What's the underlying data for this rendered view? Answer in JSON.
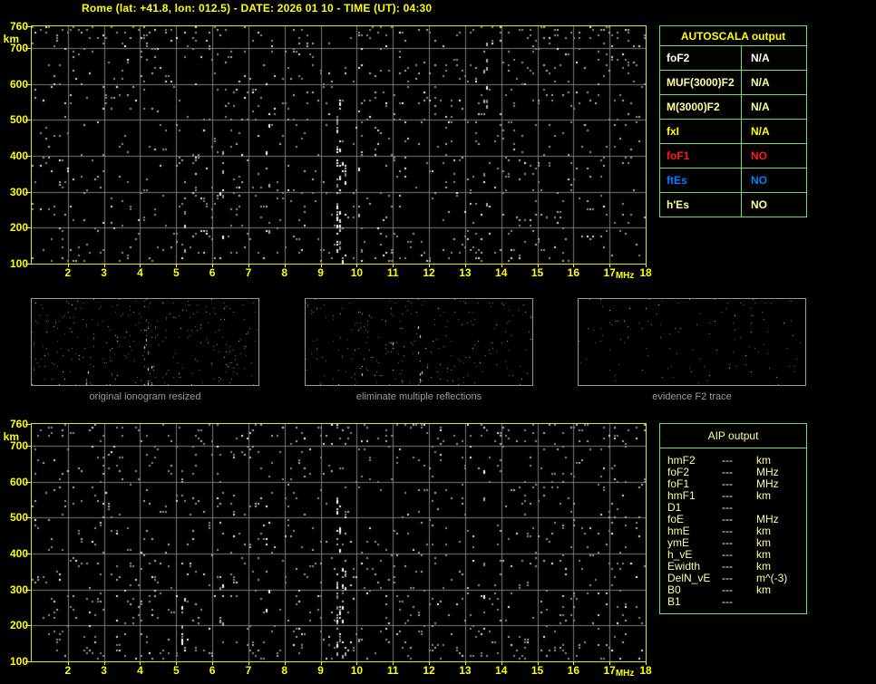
{
  "title": "Rome (lat: +41.8, lon: 012.5) - DATE: 2026 01 10 - TIME (UT): 04:30",
  "colors": {
    "accent_yellow": "#ffff00",
    "pale_yellow": "#ffff9b",
    "red": "#ff1a1a",
    "blue": "#0080ff",
    "white": "#ffffff",
    "table_border_green": "#6fde6f",
    "grid_gray": "#7b7b7b",
    "caption_gray": "#9b9b9b"
  },
  "ionogram": {
    "y_unit": "km",
    "x_unit": "MHz",
    "y_ticks": [
      "760",
      "700",
      "600",
      "500",
      "400",
      "300",
      "200",
      "100"
    ],
    "y_tick_values": [
      760,
      700,
      600,
      500,
      400,
      300,
      200,
      100
    ],
    "x_ticks": [
      "2",
      "3",
      "4",
      "5",
      "6",
      "7",
      "8",
      "9",
      "10",
      "11",
      "12",
      "13",
      "14",
      "15",
      "16",
      "17",
      "18"
    ],
    "x_tick_values": [
      2,
      3,
      4,
      5,
      6,
      7,
      8,
      9,
      10,
      11,
      12,
      13,
      14,
      15,
      16,
      17,
      18
    ],
    "freq_range_mhz": [
      1,
      18
    ],
    "height_range_km": [
      100,
      760
    ]
  },
  "chart_data": {
    "type": "heatmap",
    "title": "",
    "xlabel": "MHz",
    "ylabel": "km",
    "x_range": [
      1,
      18
    ],
    "y_range": [
      100,
      760
    ],
    "note": "Ionogram echo field contains only background speckle noise; no scaled traces (all AUTOSCALA parameters N/A)."
  },
  "autoscala_table": {
    "header": "AUTOSCALA output",
    "rows": [
      {
        "label": "foF2",
        "value": "N/A",
        "color": "#ffffff"
      },
      {
        "label": "MUF(3000)F2",
        "value": "N/A",
        "color": "#ffff9b"
      },
      {
        "label": "M(3000)F2",
        "value": "N/A",
        "color": "#ffff9b"
      },
      {
        "label": "fxI",
        "value": "N/A",
        "color": "#ffff00"
      },
      {
        "label": "foF1",
        "value": "NO",
        "color": "#ff1a1a"
      },
      {
        "label": "ftEs",
        "value": "NO",
        "color": "#0080ff"
      },
      {
        "label": "h'Es",
        "value": "NO",
        "color": "#ffff9b"
      }
    ]
  },
  "aip_table": {
    "header": "AIP output",
    "rows": [
      {
        "label": "hmF2",
        "value": "---",
        "unit": "km"
      },
      {
        "label": "foF2",
        "value": "---",
        "unit": "MHz"
      },
      {
        "label": "foF1",
        "value": "---",
        "unit": "MHz"
      },
      {
        "label": "hmF1",
        "value": "---",
        "unit": "km"
      },
      {
        "label": "D1",
        "value": "---",
        "unit": ""
      },
      {
        "label": "foE",
        "value": "---",
        "unit": "MHz"
      },
      {
        "label": "hmE",
        "value": "---",
        "unit": "km"
      },
      {
        "label": "ymE",
        "value": "---",
        "unit": "km"
      },
      {
        "label": "h_vE",
        "value": "---",
        "unit": "km"
      },
      {
        "label": "Ewidth",
        "value": "---",
        "unit": "km"
      },
      {
        "label": "DelN_vE",
        "value": "---",
        "unit": "m^(-3)"
      },
      {
        "label": "B0",
        "value": "---",
        "unit": "km"
      },
      {
        "label": "B1",
        "value": "---",
        "unit": ""
      }
    ]
  },
  "panels": [
    {
      "caption": "original ionogram resized"
    },
    {
      "caption": "eliminate multiple reflections"
    },
    {
      "caption": "evidence F2 trace"
    }
  ],
  "noise_model": {
    "ionogram_seeds": [
      1987,
      2641
    ],
    "base_density": 0.045,
    "top_band_density": 0.1,
    "bottom_band_density": 0.09,
    "lower_band_density": 0.06,
    "streaks": [
      {
        "f": 9.45,
        "y0": 0.3,
        "y1": 1.0,
        "p": 0.3
      },
      {
        "f": 9.65,
        "y0": 0.55,
        "y1": 1.0,
        "p": 0.22
      },
      {
        "f": 5.2,
        "y0": 0.72,
        "y1": 1.0,
        "p": 0.14
      },
      {
        "f": 7.5,
        "y0": 0.25,
        "y1": 0.95,
        "p": 0.08
      },
      {
        "f": 10.1,
        "y0": 0.55,
        "y1": 1.0,
        "p": 0.1
      },
      {
        "f": 13.55,
        "y0": 0.05,
        "y1": 0.75,
        "p": 0.05
      },
      {
        "f": 6.2,
        "y0": 0.5,
        "y1": 1.0,
        "p": 0.06
      }
    ],
    "panel_params": [
      {
        "seed": 421,
        "density": 0.05,
        "streak_scale": 0.7
      },
      {
        "seed": 733,
        "density": 0.045,
        "streak_scale": 0.7
      },
      {
        "seed": 911,
        "density": 0.02,
        "streak_scale": 0.0
      }
    ]
  }
}
